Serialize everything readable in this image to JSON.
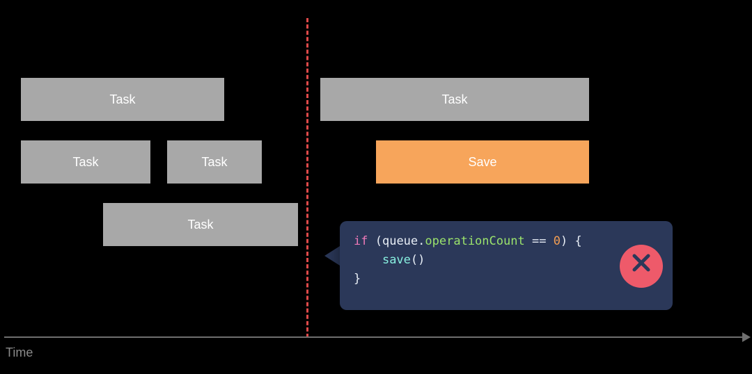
{
  "axis_label": "Time",
  "boxes": {
    "left_row1": "Task",
    "left_row2a": "Task",
    "left_row2b": "Task",
    "left_row3": "Task",
    "right_row1": "Task",
    "right_save": "Save"
  },
  "code": {
    "kw_if": "if",
    "lparen1": " (",
    "ident_queue": "queue",
    "dot": ".",
    "prop_opcount": "operationCount",
    "space_op": " ",
    "op_eq": "==",
    "space_num": " ",
    "num_zero": "0",
    "rparen1": ")",
    "space_brace": " ",
    "lbrace": "{",
    "indent": "    ",
    "call_save": "save",
    "call_parens": "()",
    "rbrace": "}"
  },
  "icons": {
    "close": "close-icon"
  },
  "colors": {
    "task_fill": "#a8a8a8",
    "save_fill": "#f7a55b",
    "callout_fill": "#2b3859",
    "divider": "#e04a4a",
    "badge": "#ee5a6a"
  }
}
